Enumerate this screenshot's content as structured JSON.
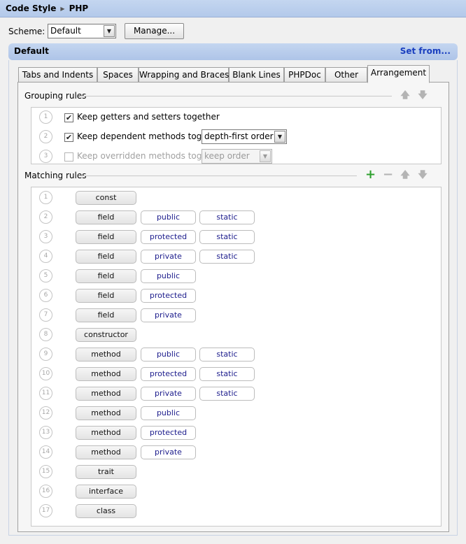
{
  "titlebar": {
    "part1": "Code Style",
    "sep": "▶",
    "part2": "PHP"
  },
  "scheme": {
    "label": "Scheme:",
    "value": "Default",
    "manage_label": "Manage..."
  },
  "section": {
    "title": "Default",
    "set_from": "Set from..."
  },
  "tabs": [
    {
      "label": "Tabs and Indents"
    },
    {
      "label": "Spaces"
    },
    {
      "label": "Wrapping and Braces"
    },
    {
      "label": "Blank Lines"
    },
    {
      "label": "PHPDoc"
    },
    {
      "label": "Other"
    },
    {
      "label": "Arrangement",
      "active": true
    }
  ],
  "grouping": {
    "title": "Grouping rules",
    "rules": [
      {
        "num": "1",
        "label": "Keep getters and setters together",
        "checked": true,
        "enabled": true
      },
      {
        "num": "2",
        "label": "Keep dependent methods together",
        "checked": true,
        "enabled": true,
        "select": "depth-first order"
      },
      {
        "num": "3",
        "label": "Keep overridden methods together",
        "checked": false,
        "enabled": false,
        "select": "keep order"
      }
    ]
  },
  "matching": {
    "title": "Matching rules",
    "rules": [
      {
        "num": "1",
        "kind": "const",
        "mods": []
      },
      {
        "num": "2",
        "kind": "field",
        "mods": [
          "public",
          "static"
        ]
      },
      {
        "num": "3",
        "kind": "field",
        "mods": [
          "protected",
          "static"
        ]
      },
      {
        "num": "4",
        "kind": "field",
        "mods": [
          "private",
          "static"
        ]
      },
      {
        "num": "5",
        "kind": "field",
        "mods": [
          "public"
        ]
      },
      {
        "num": "6",
        "kind": "field",
        "mods": [
          "protected"
        ]
      },
      {
        "num": "7",
        "kind": "field",
        "mods": [
          "private"
        ]
      },
      {
        "num": "8",
        "kind": "constructor",
        "mods": []
      },
      {
        "num": "9",
        "kind": "method",
        "mods": [
          "public",
          "static"
        ]
      },
      {
        "num": "10",
        "kind": "method",
        "mods": [
          "protected",
          "static"
        ]
      },
      {
        "num": "11",
        "kind": "method",
        "mods": [
          "private",
          "static"
        ]
      },
      {
        "num": "12",
        "kind": "method",
        "mods": [
          "public"
        ]
      },
      {
        "num": "13",
        "kind": "method",
        "mods": [
          "protected"
        ]
      },
      {
        "num": "14",
        "kind": "method",
        "mods": [
          "private"
        ]
      },
      {
        "num": "15",
        "kind": "trait",
        "mods": []
      },
      {
        "num": "16",
        "kind": "interface",
        "mods": []
      },
      {
        "num": "17",
        "kind": "class",
        "mods": []
      }
    ]
  },
  "icons": {
    "move_up": "arrow-up-icon",
    "move_down": "arrow-down-icon",
    "add": "plus-icon",
    "remove": "minus-icon",
    "dropdown": "chevron-down-icon",
    "check": "checkmark-icon"
  },
  "glyphs": {
    "up": "🡅",
    "down": "🡇",
    "plus": "+",
    "minus": "−",
    "dropdown": "▼",
    "check": "✔"
  },
  "colors": {
    "accent_header": "#b8cdea",
    "link": "#1a3fbf",
    "add": "#2ea02e",
    "modifier_text": "#1c1c8c"
  }
}
